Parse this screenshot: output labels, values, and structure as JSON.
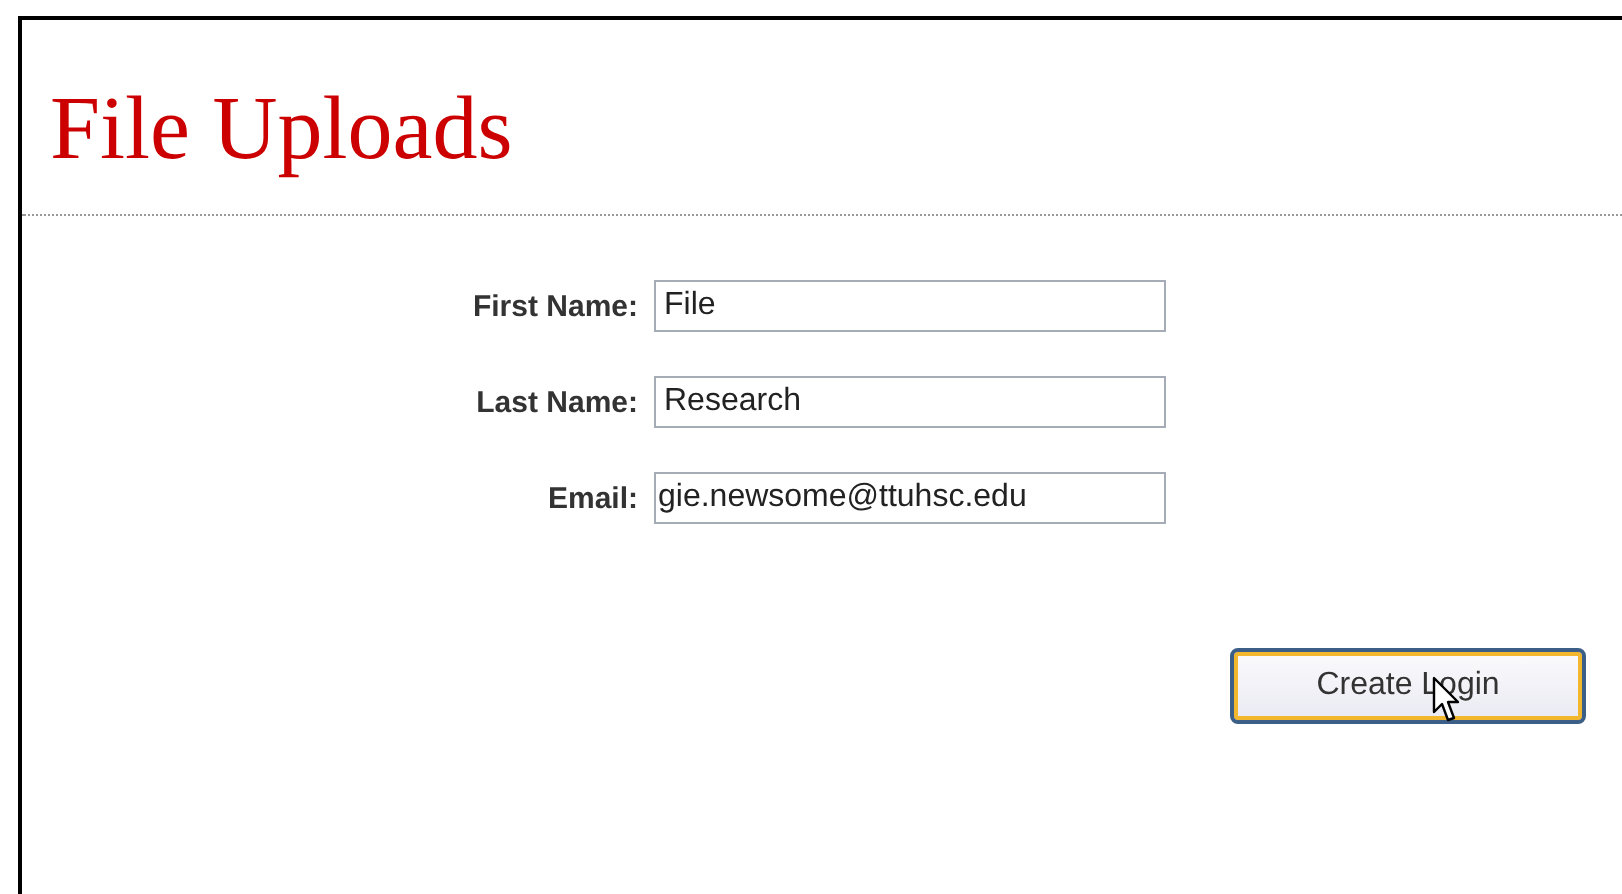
{
  "page": {
    "title": "File Uploads"
  },
  "fields": [
    {
      "label": "First Name:",
      "value": "File"
    },
    {
      "label": "Last Name:",
      "value": "Research"
    },
    {
      "label": "Email:",
      "value": "gie.newsome@ttuhsc.edu"
    }
  ],
  "button": {
    "label": "Create Login"
  }
}
